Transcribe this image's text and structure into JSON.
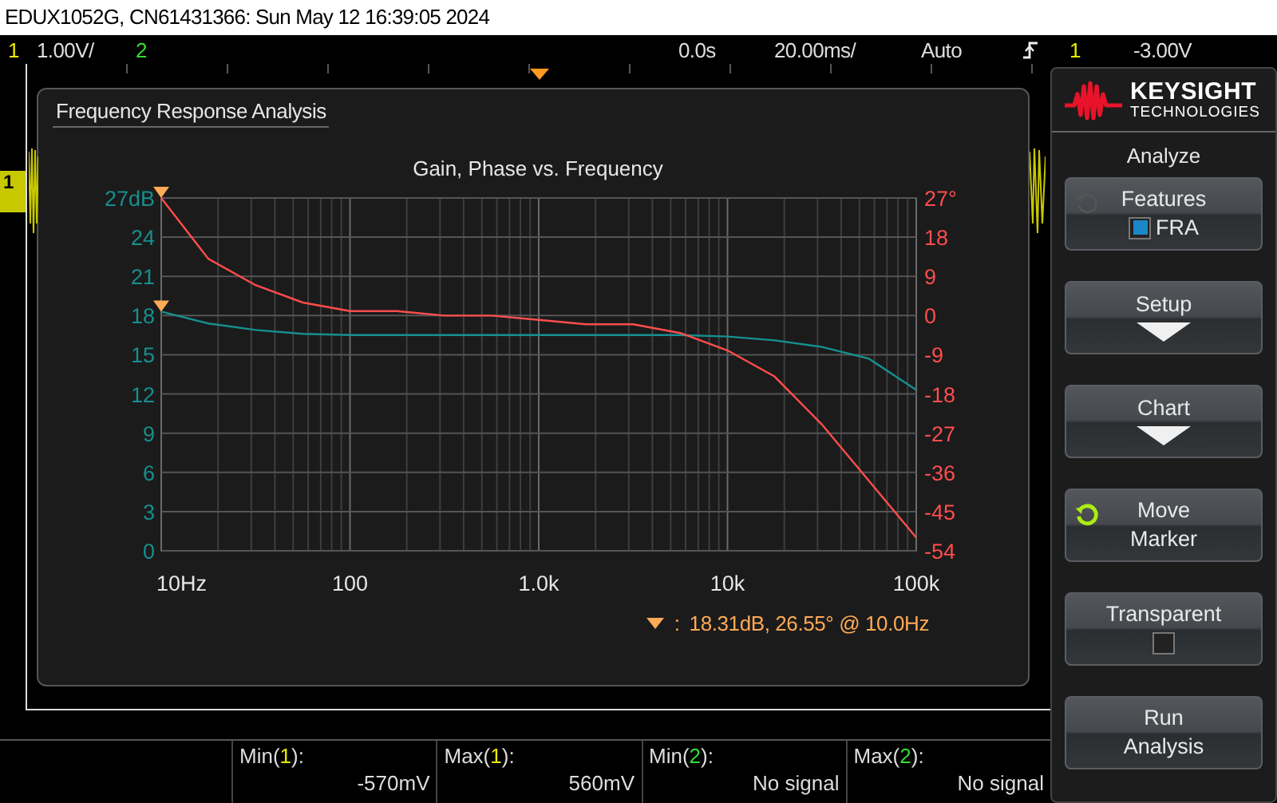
{
  "title_bar": {
    "text": "EDUX1052G, CN61431366: Sun May 12 16:39:05 2024"
  },
  "status_bar": {
    "channel_1": {
      "number": "1",
      "scale": "1.00V/",
      "color": "#e8e800"
    },
    "channel_2": {
      "number": "2",
      "color": "#33dd33"
    },
    "time_offset": "0.0s",
    "time_scale": "20.00ms/",
    "trigger_mode": "Auto",
    "trigger_source": {
      "number": "1",
      "color": "#e8e800"
    },
    "trigger_level": "-3.00V"
  },
  "ground_marker": {
    "number": "1"
  },
  "dialog": {
    "title": "Frequency Response Analysis",
    "chart_data": {
      "type": "line",
      "title": "Gain, Phase vs. Frequency",
      "categories": [
        "10Hz",
        null,
        null,
        null,
        "100",
        null,
        null,
        null,
        "1.0k",
        null,
        null,
        null,
        "10k",
        null,
        null,
        null,
        "100k"
      ],
      "series": [
        {
          "color": "#178f8f",
          "values": [
            18.3,
            17.4,
            16.9,
            16.6,
            16.5,
            16.5,
            16.5,
            16.5,
            16.5,
            16.5,
            16.5,
            16.5,
            16.4,
            16.1,
            15.6,
            14.7,
            12.3
          ]
        },
        {
          "color": "#ff4d4d",
          "axis": "y2",
          "values": [
            27,
            13,
            7,
            3,
            1,
            1,
            0,
            0,
            -1,
            -2,
            -2,
            -4,
            -8,
            -14,
            -25,
            -38,
            -51
          ]
        }
      ],
      "grid": true,
      "ylim": [
        0,
        27
      ],
      "yticks": [
        {
          "value": 27,
          "label": "27dB"
        },
        24,
        21,
        18,
        15,
        12,
        9,
        6,
        3,
        0
      ],
      "y2lim": [
        -54,
        27
      ],
      "y2ticks": [
        {
          "value": 27,
          "label": "27°"
        },
        18,
        9,
        0,
        -9,
        -18,
        -27,
        -36,
        -45,
        -54
      ]
    },
    "readout": {
      "separator": ":",
      "text": "18.31dB, 26.55° @ 10.0Hz"
    }
  },
  "measurements": [
    {
      "prefix": "Min(",
      "channel": "1",
      "suffix": "):",
      "value": "-570mV",
      "color": "#e8e800"
    },
    {
      "prefix": "Max(",
      "channel": "1",
      "suffix": "):",
      "value": "560mV",
      "color": "#e8e800"
    },
    {
      "prefix": "Min(",
      "channel": "2",
      "suffix": "):",
      "value": "No signal",
      "color": "#33dd33"
    },
    {
      "prefix": "Max(",
      "channel": "2",
      "suffix": "):",
      "value": "No signal",
      "color": "#33dd33"
    }
  ],
  "side_panel": {
    "logo": {
      "name": "KEYSIGHT",
      "subtitle": "TECHNOLOGIES"
    },
    "menu_title": "Analyze",
    "softkeys": [
      {
        "kind": "check",
        "lines": [
          "Features"
        ],
        "option": "FRA",
        "checked": true,
        "knob_active": false
      },
      {
        "kind": "submenu",
        "lines": [
          "Setup"
        ]
      },
      {
        "kind": "submenu",
        "lines": [
          "Chart"
        ]
      },
      {
        "kind": "action",
        "lines": [
          "Move",
          "Marker"
        ],
        "knob_active": true
      },
      {
        "kind": "check",
        "lines": [
          "Transparent"
        ],
        "checked": false
      },
      {
        "kind": "action",
        "lines": [
          "Run",
          "Analysis"
        ]
      }
    ]
  }
}
